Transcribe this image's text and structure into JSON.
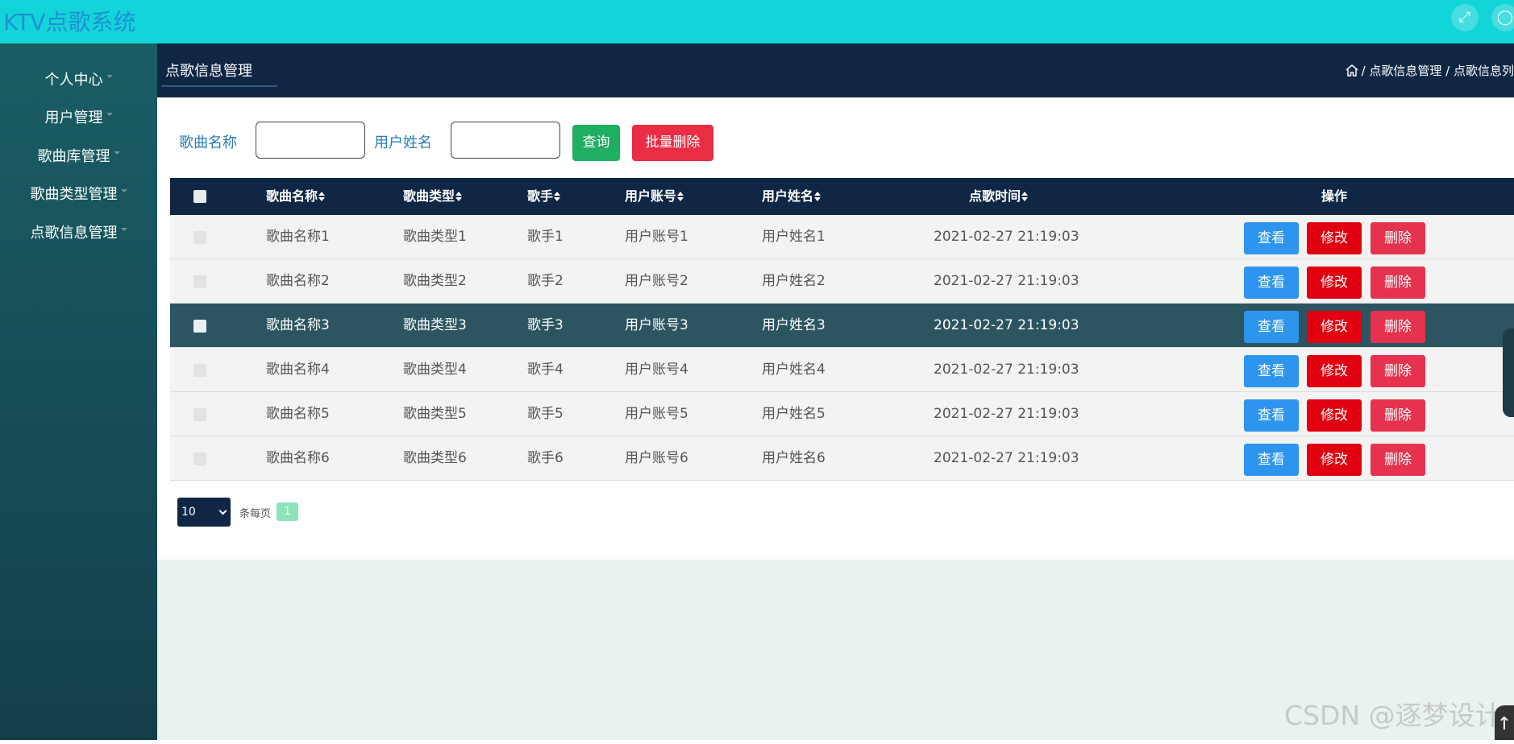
{
  "app": {
    "title": "KTV点歌系统",
    "fullscreen_icon": "expand-icon",
    "user_icon": "user-icon"
  },
  "sidebar": {
    "items": [
      {
        "label": "个人中心"
      },
      {
        "label": "用户管理"
      },
      {
        "label": "歌曲库管理"
      },
      {
        "label": "歌曲类型管理"
      },
      {
        "label": "点歌信息管理"
      }
    ]
  },
  "header": {
    "tab_label": "点歌信息管理",
    "breadcrumb": [
      "/ 点歌信息管理",
      "/ 点歌信息列"
    ]
  },
  "search": {
    "song_label": "歌曲名称",
    "song_value": "",
    "user_label": "用户姓名",
    "user_value": "",
    "query_label": "查询",
    "batch_delete_label": "批量删除"
  },
  "table": {
    "columns": [
      "歌曲名称",
      "歌曲类型",
      "歌手",
      "用户账号",
      "用户姓名",
      "点歌时间",
      "操作"
    ],
    "rows": [
      {
        "song": "歌曲名称1",
        "type": "歌曲类型1",
        "singer": "歌手1",
        "account": "用户账号1",
        "name": "用户姓名1",
        "time": "2021-02-27 21:19:03"
      },
      {
        "song": "歌曲名称2",
        "type": "歌曲类型2",
        "singer": "歌手2",
        "account": "用户账号2",
        "name": "用户姓名2",
        "time": "2021-02-27 21:19:03"
      },
      {
        "song": "歌曲名称3",
        "type": "歌曲类型3",
        "singer": "歌手3",
        "account": "用户账号3",
        "name": "用户姓名3",
        "time": "2021-02-27 21:19:03"
      },
      {
        "song": "歌曲名称4",
        "type": "歌曲类型4",
        "singer": "歌手4",
        "account": "用户账号4",
        "name": "用户姓名4",
        "time": "2021-02-27 21:19:03"
      },
      {
        "song": "歌曲名称5",
        "type": "歌曲类型5",
        "singer": "歌手5",
        "account": "用户账号5",
        "name": "用户姓名5",
        "time": "2021-02-27 21:19:03"
      },
      {
        "song": "歌曲名称6",
        "type": "歌曲类型6",
        "singer": "歌手6",
        "account": "用户账号6",
        "name": "用户姓名6",
        "time": "2021-02-27 21:19:03"
      }
    ],
    "actions": {
      "view": "查看",
      "edit": "修改",
      "delete": "删除"
    },
    "highlighted_row": 3
  },
  "pagination": {
    "page_size": "10",
    "per_page_label": "条每页",
    "current_page": "1"
  },
  "watermark": "CSDN @逐梦设计",
  "colors": {
    "topbar": "#13d4d8",
    "navy": "#0f2744",
    "sidebar": "#1a5d64",
    "view": "#2e95ef",
    "edit": "#e00010",
    "delete": "#e5334f",
    "query": "#1fae62"
  }
}
